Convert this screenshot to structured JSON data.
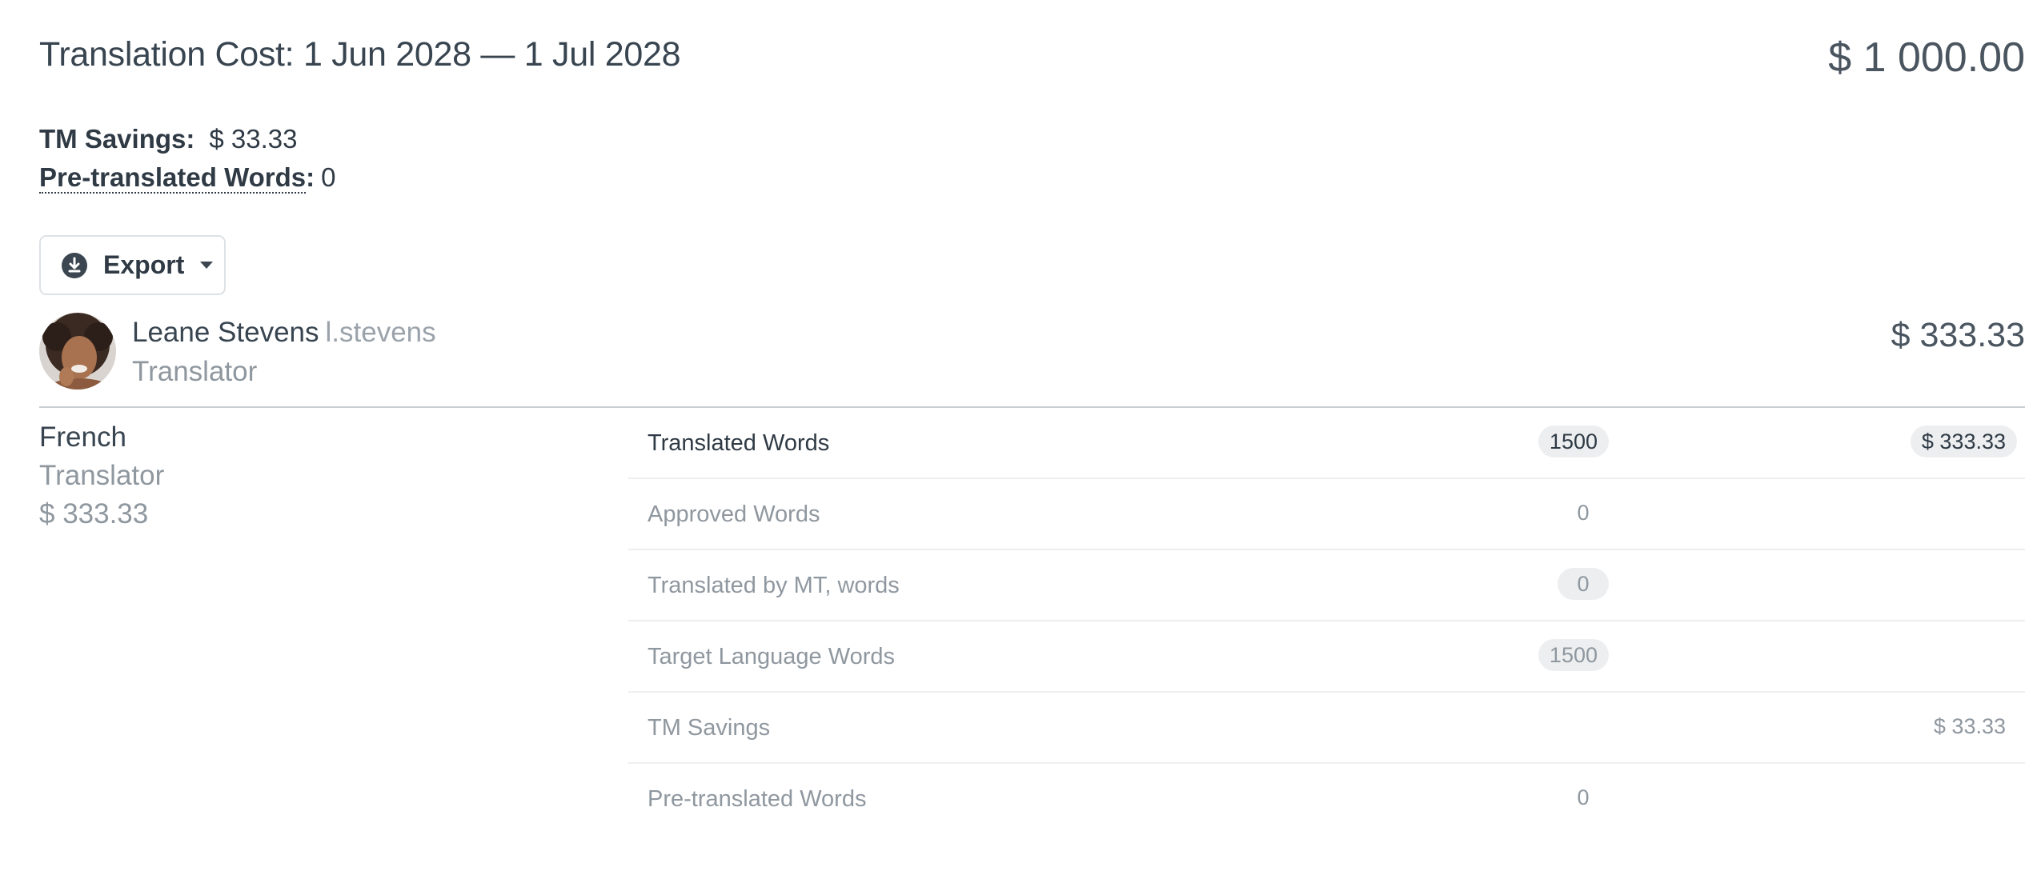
{
  "header": {
    "title": "Translation Cost: 1 Jun 2028 — 1 Jul 2028",
    "total_cost": "$ 1 000.00"
  },
  "summary": {
    "tm_savings_label": "TM Savings:",
    "tm_savings_value": "$ 33.33",
    "pretranslated_label": "Pre-translated Words",
    "pretranslated_value": "0"
  },
  "toolbar": {
    "export_label": "Export",
    "export_icon": "download-icon"
  },
  "user": {
    "name": "Leane Stevens",
    "login": "l.stevens",
    "role": "Translator",
    "cost": "$ 333.33"
  },
  "language": {
    "name": "French",
    "role": "Translator",
    "cost": "$ 333.33"
  },
  "stats": {
    "rows": [
      {
        "label": "Translated Words",
        "count": "1500",
        "amount": "$ 333.33"
      },
      {
        "label": "Approved Words",
        "count": "0",
        "amount": ""
      },
      {
        "label": "Translated by MT, words",
        "count": "0",
        "amount": ""
      },
      {
        "label": "Target Language Words",
        "count": "1500",
        "amount": ""
      },
      {
        "label": "TM Savings",
        "count": "",
        "amount": "$ 33.33"
      },
      {
        "label": "Pre-translated Words",
        "count": "0",
        "amount": ""
      }
    ]
  },
  "colors": {
    "text_primary": "#2f3a45",
    "text_muted": "#8f979f",
    "pill_bg": "#eceef0",
    "divider": "#c9ced3"
  }
}
